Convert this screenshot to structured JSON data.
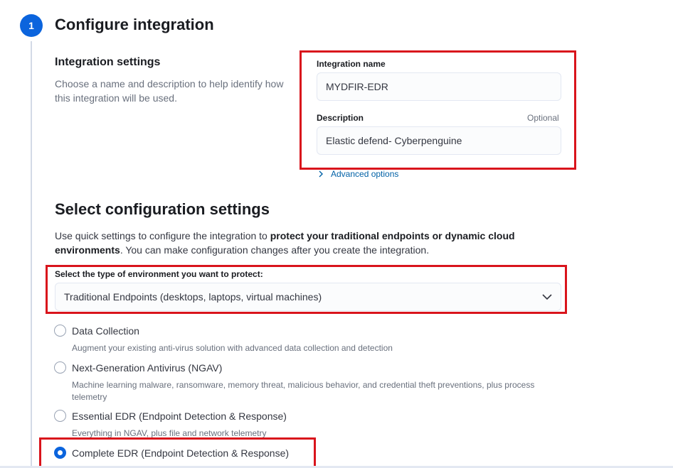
{
  "step": {
    "number": "1",
    "title": "Configure integration"
  },
  "integration_settings": {
    "title": "Integration settings",
    "description": "Choose a name and description to help identify how this integration will be used.",
    "name_label": "Integration name",
    "name_value": "MYDFIR-EDR",
    "description_label": "Description",
    "description_optional": "Optional",
    "description_value": "Elastic defend- Cyberpenguine",
    "advanced_options": "Advanced options"
  },
  "config": {
    "title": "Select configuration settings",
    "desc_part1": "Use quick settings to configure the integration to ",
    "desc_bold": "protect your traditional endpoints or dynamic cloud environments",
    "desc_part2": ". You can make configuration changes after you create the integration.",
    "env_label": "Select the type of environment you want to protect:",
    "env_value": "Traditional Endpoints (desktops, laptops, virtual machines)"
  },
  "options": [
    {
      "label": "Data Collection",
      "desc": "Augment your existing anti-virus solution with advanced data collection and detection",
      "selected": false
    },
    {
      "label": "Next-Generation Antivirus (NGAV)",
      "desc": "Machine learning malware, ransomware, memory threat, malicious behavior, and credential theft preventions, plus process telemetry",
      "selected": false
    },
    {
      "label": "Essential EDR (Endpoint Detection & Response)",
      "desc": "Everything in NGAV, plus file and network telemetry",
      "selected": false
    },
    {
      "label": "Complete EDR (Endpoint Detection & Response)",
      "desc": "",
      "selected": true
    }
  ],
  "colors": {
    "accent": "#0b64dd",
    "highlight": "#d9141c",
    "link": "#0061a6"
  }
}
